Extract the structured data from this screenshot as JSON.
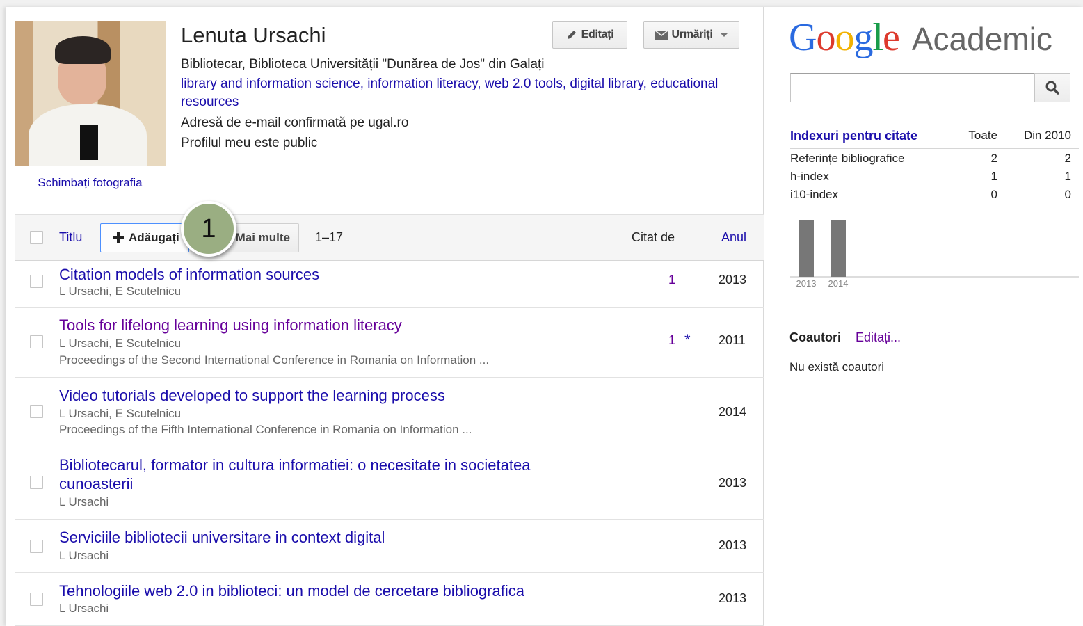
{
  "profile": {
    "name": "Lenuta Ursachi",
    "affiliation": "Bibliotecar, Biblioteca Universității \"Dunărea de Jos\" din Galați",
    "interests": [
      "library and information science",
      "information literacy",
      "web 2.0 tools",
      "digital library",
      "educational resources"
    ],
    "interests_sep": ", ",
    "email_note": "Adresă de e-mail confirmată pe ugal.ro",
    "public_note": "Profilul meu este public",
    "change_photo": "Schimbați fotografia"
  },
  "header_buttons": {
    "edit": "Editați",
    "follow": "Urmăriți"
  },
  "toolbar": {
    "title_col": "Titlu",
    "add": "Adăugați",
    "more": "Mai multe",
    "range": "1–17",
    "cited_by": "Citat de",
    "year": "Anul"
  },
  "step_badge": "1",
  "articles": [
    {
      "title": "Citation models of information sources",
      "authors": "L Ursachi, E Scutelnicu",
      "venue": "",
      "cited": "1",
      "star": "",
      "year": "2013"
    },
    {
      "title": "Tools for lifelong learning using information literacy",
      "authors": "L Ursachi, E Scutelnicu",
      "venue": "Proceedings of the Second International Conference in Romania on Information ...",
      "cited": "1",
      "star": "*",
      "year": "2011"
    },
    {
      "title": "Video tutorials developed to support the learning process",
      "authors": "L Ursachi, E Scutelnicu",
      "venue": "Proceedings of the Fifth International Conference in Romania on Information ...",
      "cited": "",
      "star": "",
      "year": "2014"
    },
    {
      "title": "Bibliotecarul, formator in cultura informatiei: o necesitate in societatea cunoasterii",
      "authors": "L Ursachi",
      "venue": "",
      "cited": "",
      "star": "",
      "year": "2013"
    },
    {
      "title": "Serviciile bibliotecii universitare in context digital",
      "authors": "L Ursachi",
      "venue": "",
      "cited": "",
      "star": "",
      "year": "2013"
    },
    {
      "title": "Tehnologiile web 2.0 in biblioteci: un model de cercetare bibliografica",
      "authors": "L Ursachi",
      "venue": "",
      "cited": "",
      "star": "",
      "year": "2013"
    }
  ],
  "sidebar": {
    "logo_google": "Google",
    "logo_product": "Academic",
    "search_placeholder": "",
    "indices": {
      "title": "Indexuri pentru citate",
      "col_all": "Toate",
      "col_since": "Din 2010",
      "rows": [
        {
          "name": "Referințe bibliografice",
          "all": "2",
          "since": "2"
        },
        {
          "name": "h-index",
          "all": "1",
          "since": "1"
        },
        {
          "name": "i10-index",
          "all": "0",
          "since": "0"
        }
      ]
    },
    "coauthors": {
      "title": "Coautori",
      "edit": "Editați...",
      "none": "Nu există coautori"
    }
  },
  "colors": {
    "link": "#1a0dab",
    "visited": "#660099",
    "bar": "#777777",
    "accent_blue": "#4d90fe",
    "badge": "#9aae82"
  },
  "chart_data": {
    "type": "bar",
    "categories": [
      "2013",
      "2014"
    ],
    "values": [
      1,
      1
    ],
    "ylim": [
      0,
      1
    ],
    "grid": false
  }
}
